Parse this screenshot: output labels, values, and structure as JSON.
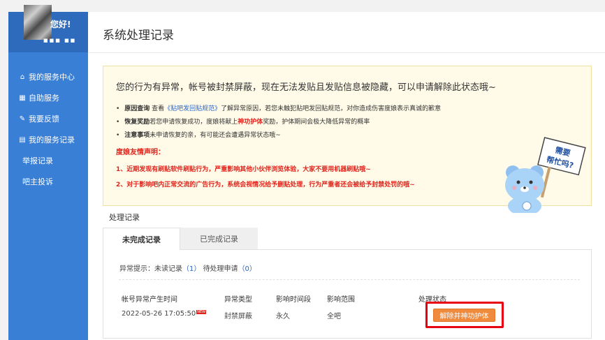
{
  "sidebar": {
    "greeting": "您好!",
    "masked_name": "■■■ ■■",
    "items": [
      {
        "label": "我的服务中心",
        "icon": "home-icon"
      },
      {
        "label": "自助服务",
        "icon": "grid-icon"
      },
      {
        "label": "我要反馈",
        "icon": "pencil-icon"
      },
      {
        "label": "我的服务记录",
        "icon": "clipboard-icon"
      },
      {
        "label": "举报记录",
        "icon": ""
      },
      {
        "label": "吧主投诉",
        "icon": ""
      }
    ]
  },
  "page": {
    "title": "系统处理记录"
  },
  "notice": {
    "headline": "您的行为有异常，帐号被封禁屏蔽，现在无法发贴且发贴信息被隐藏，可以申请解除此状态哦~",
    "bullets": [
      {
        "label": "原因查询",
        "pre": " 查看",
        "link": "《贴吧发回贴规范》",
        "post": "了解异常原因，若您未触犯贴吧发回贴规范，对你造成伤害度娘表示真诚的歉意"
      },
      {
        "label": "恢复奖励",
        "pre": "若您申请恢复成功，度娘将献上",
        "highlight": "神功护体",
        "post": "奖励，护体期间会极大降低异常的概率"
      },
      {
        "label": "注意事项",
        "pre": "未申请恢复的亲，有可能还会遭遇异常状态哦~"
      }
    ],
    "declaration_title": "度娘友情声明：",
    "declarations": [
      "1、近期发现有刷贴软件刷贴行为，严重影响其他小伙伴浏览体验，大家不要用机器刷贴哦~",
      "2、对于影响吧内正常交流的广告行为，系统会视情况给予删贴处理，行为严重者还会被给予封禁处罚的哦~"
    ],
    "bear_sign": [
      "需要",
      "帮忙吗?"
    ]
  },
  "records": {
    "section_title": "处理记录",
    "tabs": [
      {
        "label": "未完成记录"
      },
      {
        "label": "已完成记录"
      }
    ],
    "abnormal_label": "异常提示：未读记录",
    "unread_count": "（1）",
    "pending_label": "待处理申请",
    "pending_count": "（0）",
    "columns": [
      "帐号异常产生时间",
      "异常类型",
      "影响时间段",
      "影响范围",
      "处理状态"
    ],
    "row": {
      "time": "2022-05-26 17:05:50",
      "new_badge": "NEW",
      "type": "封禁屏蔽",
      "duration": "永久",
      "scope": "全吧",
      "action": "解除并神功护体"
    }
  },
  "colors": {
    "sidebar": "#3a7fd6",
    "alert_red": "#e0241c",
    "button_orange": "#f08a3c",
    "link": "#2a64c8"
  }
}
